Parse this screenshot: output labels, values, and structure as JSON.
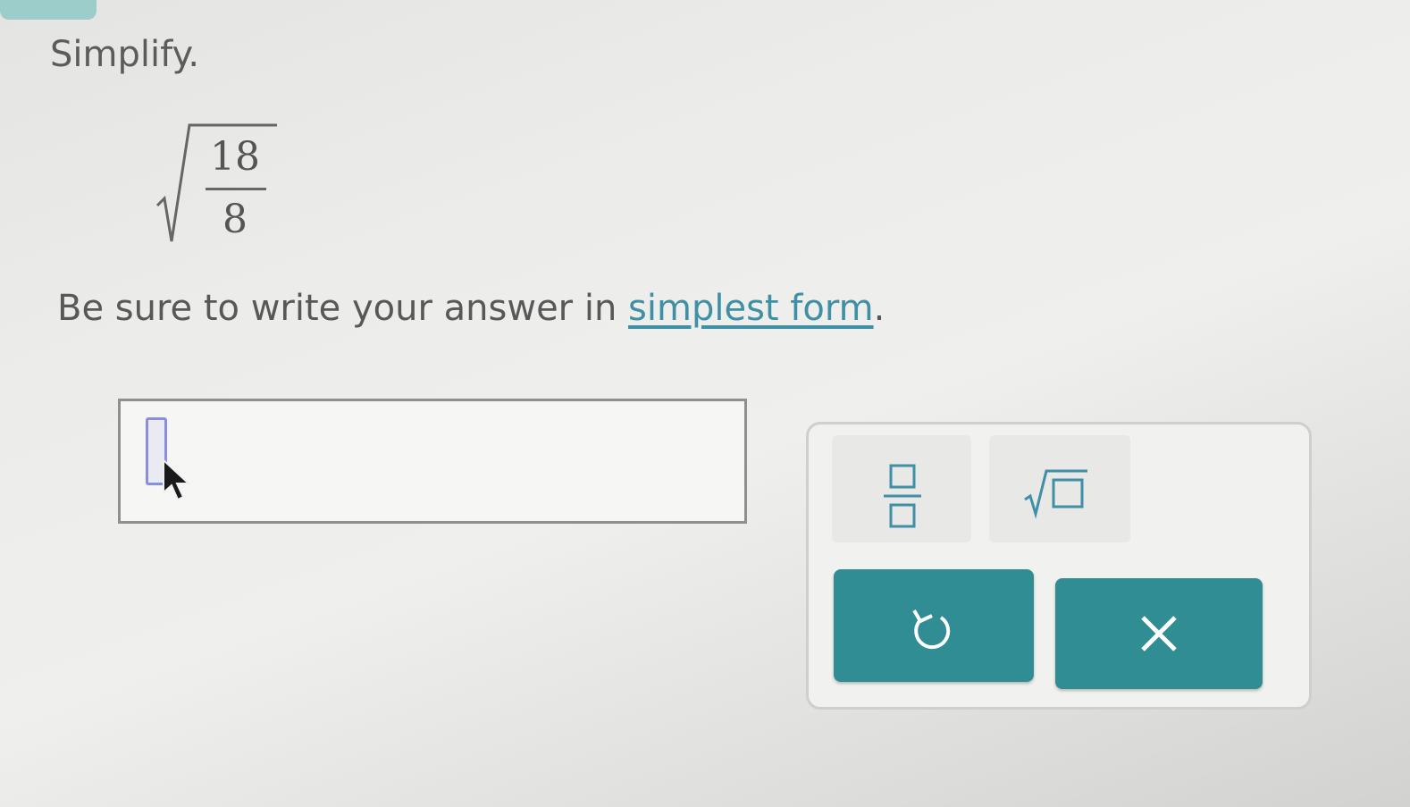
{
  "question": {
    "instruction": "Simplify.",
    "numerator": "18",
    "denominator": "8"
  },
  "note": {
    "prefix": "Be sure to write your answer in ",
    "link": "simplest form",
    "suffix": "."
  },
  "answer": {
    "value": ""
  },
  "keypad": {
    "keys": [
      {
        "name": "fraction",
        "icon": "fraction-template-icon"
      },
      {
        "name": "square-root",
        "icon": "square-root-template-icon"
      }
    ],
    "actions": [
      {
        "name": "undo",
        "icon": "undo-icon"
      },
      {
        "name": "clear",
        "icon": "close-icon"
      }
    ]
  },
  "colors": {
    "accent": "#2f8d93",
    "link": "#3f8fa5",
    "text": "#585858"
  }
}
